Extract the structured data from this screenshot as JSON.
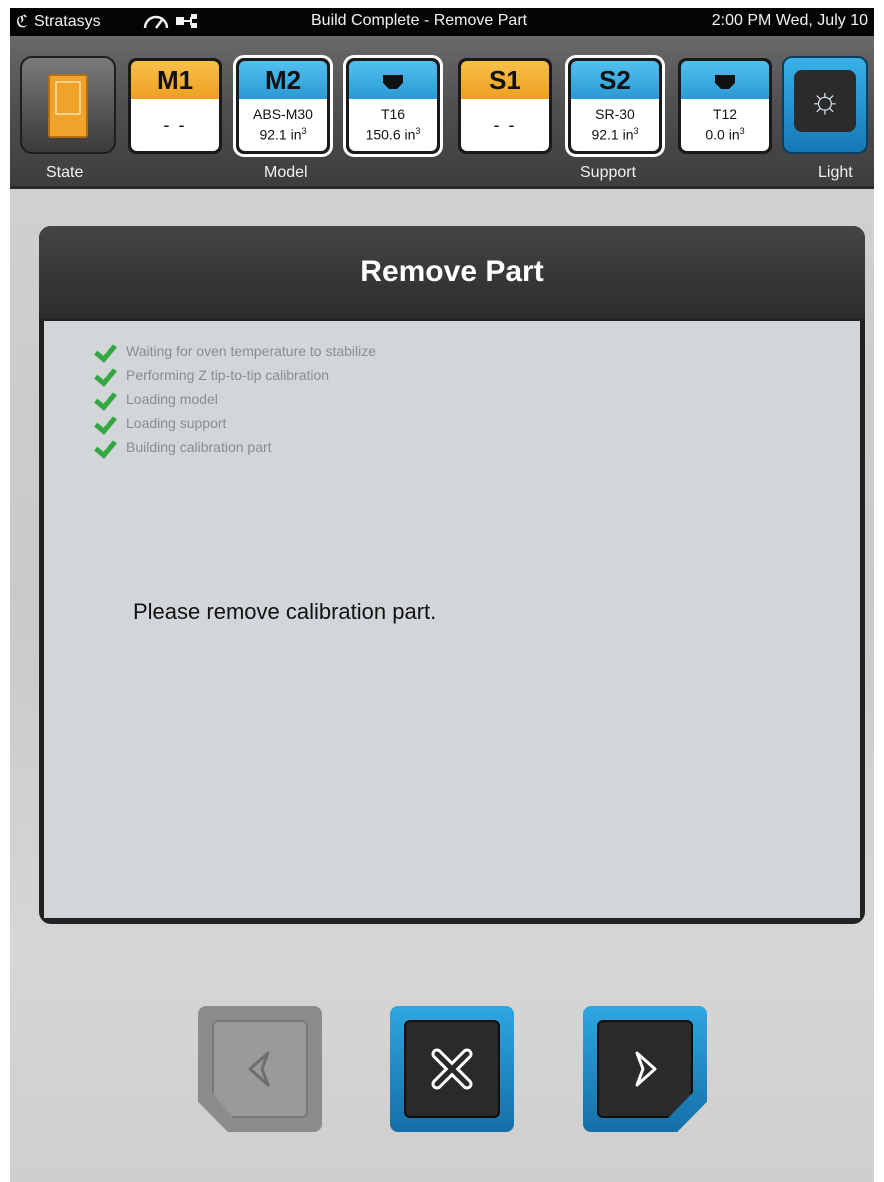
{
  "status_bar": {
    "brand": "Stratasys",
    "title": "Build Complete - Remove Part",
    "clock": "2:00 PM Wed, July 10",
    "icons": [
      "brand-logo-icon",
      "gauge-icon",
      "network-icon"
    ]
  },
  "toolbar": {
    "state_label": "State",
    "model_label": "Model",
    "support_label": "Support",
    "light_label": "Light",
    "tiles": [
      {
        "header": "M1",
        "line1": "- -",
        "line2": "",
        "color": "#eca021",
        "selected": false
      },
      {
        "header": "M2",
        "line1": "ABS-M30",
        "line2": "92.1 in",
        "sup": "3",
        "color": "#2a9ad4",
        "selected": true
      },
      {
        "header": "nozzle-icon",
        "line1": "T16",
        "line2": "150.6 in",
        "sup": "3",
        "color": "#2a9ad4",
        "selected": true
      },
      {
        "header": "S1",
        "line1": "- -",
        "line2": "",
        "color": "#eca021",
        "selected": false
      },
      {
        "header": "S2",
        "line1": "SR-30",
        "line2": "92.1 in",
        "sup": "3",
        "color": "#2a9ad4",
        "selected": true
      },
      {
        "header": "nozzle-icon",
        "line1": "T12",
        "line2": "0.0 in",
        "sup": "3",
        "color": "#2a9ad4",
        "selected": false
      }
    ]
  },
  "dialog": {
    "title": "Remove Part",
    "steps": [
      "Waiting for oven temperature to stabilize",
      "Performing Z tip-to-tip calibration",
      "Loading model",
      "Loading support",
      "Building calibration part"
    ],
    "message": "Please remove calibration part."
  },
  "nav": {
    "back": {
      "icon": "back-arrow-icon",
      "enabled": false
    },
    "cancel": {
      "icon": "close-icon",
      "enabled": true
    },
    "next": {
      "icon": "next-arrow-icon",
      "enabled": true
    }
  },
  "colors": {
    "accent_blue": "#2a9ad4",
    "accent_orange": "#eca021",
    "check_green": "#35a845"
  }
}
